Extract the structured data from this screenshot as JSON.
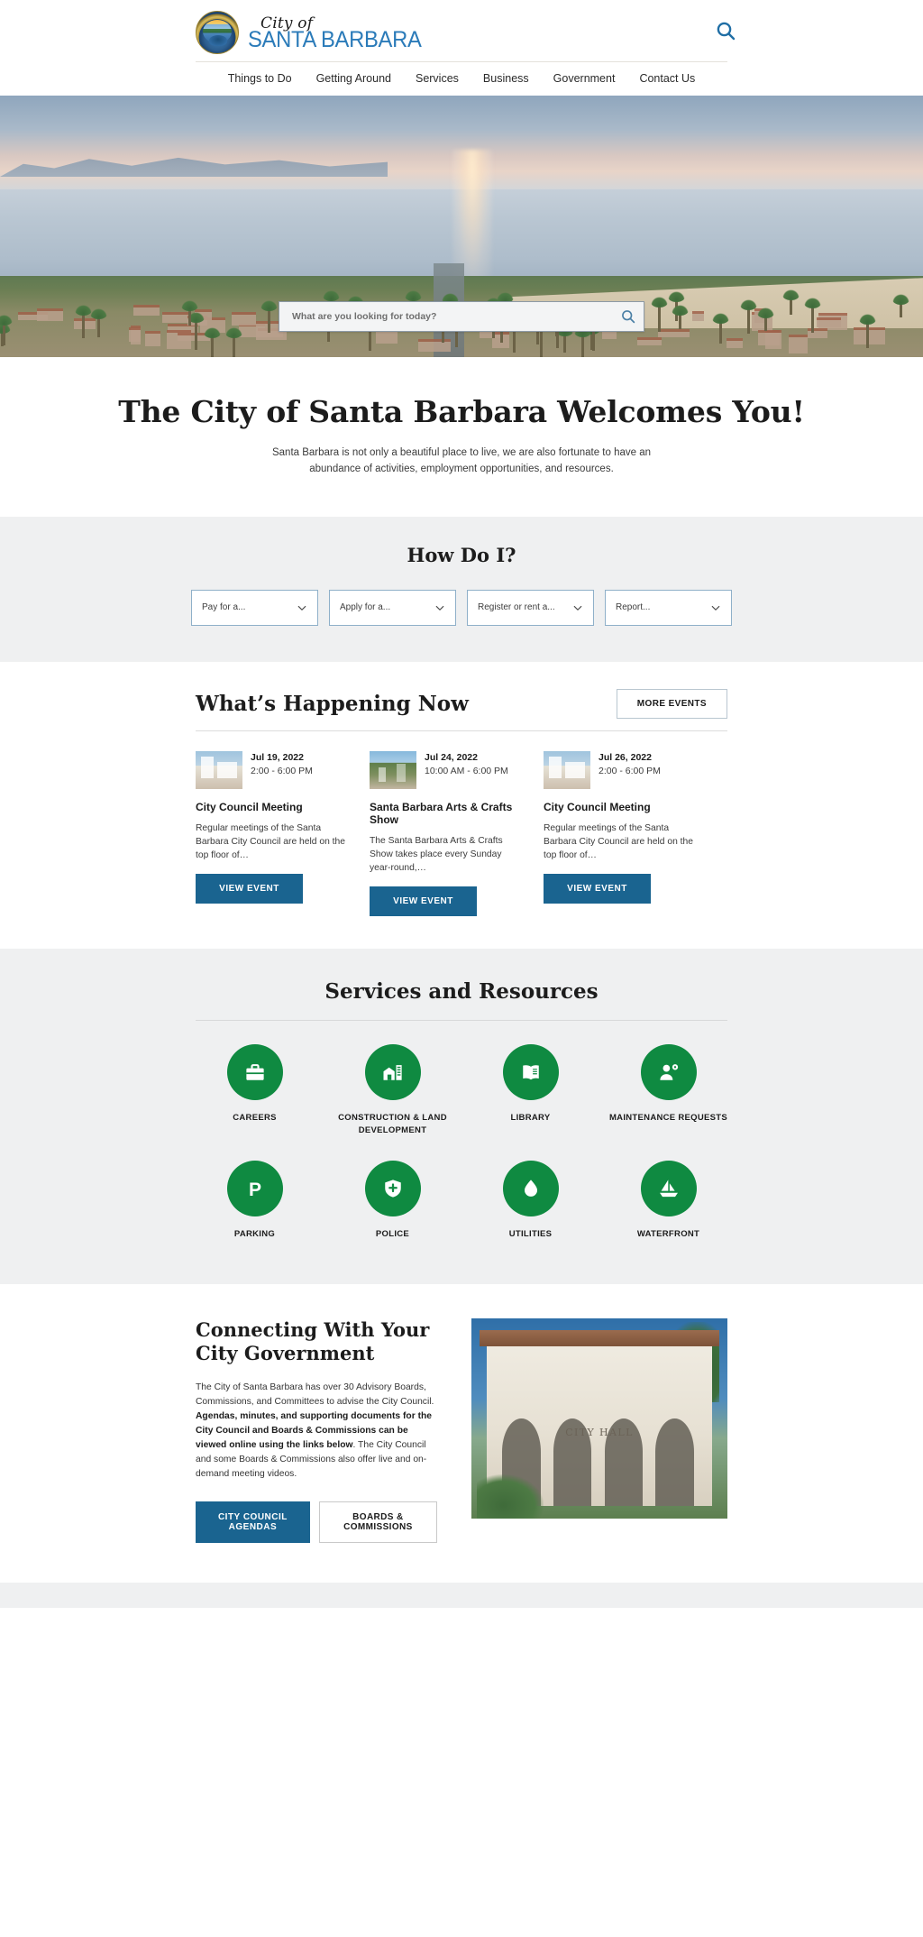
{
  "header": {
    "logo_script": "City of",
    "logo_city": "SANTA BARBARA",
    "search_icon": "search-icon",
    "nav": [
      {
        "label": "Things to Do"
      },
      {
        "label": "Getting Around"
      },
      {
        "label": "Services"
      },
      {
        "label": "Business"
      },
      {
        "label": "Government"
      },
      {
        "label": "Contact Us"
      }
    ]
  },
  "hero": {
    "search_placeholder": "What are you looking for today?",
    "search_value": "",
    "search_icon": "search-icon"
  },
  "welcome": {
    "heading": "The City of Santa Barbara Welcomes You!",
    "body": "Santa Barbara is not only a beautiful place to live, we are also fortunate to have an abundance of activities, employment opportunities, and resources."
  },
  "how_do_i": {
    "heading": "How Do I?",
    "dropdowns": [
      {
        "label": "Pay for a...",
        "icon": "chevron-down-icon"
      },
      {
        "label": "Apply for a...",
        "icon": "chevron-down-icon"
      },
      {
        "label": "Register or rent a...",
        "icon": "chevron-down-icon"
      },
      {
        "label": "Report...",
        "icon": "chevron-down-icon"
      }
    ]
  },
  "happening": {
    "heading": "What’s Happening Now",
    "more_events_label": "MORE EVENTS",
    "events": [
      {
        "date": "Jul 19, 2022",
        "time": "2:00 - 6:00 PM",
        "title": "City Council Meeting",
        "desc": "Regular meetings of the Santa Barbara City Council are held on the top floor of…",
        "button": "VIEW EVENT"
      },
      {
        "date": "Jul 24, 2022",
        "time": "10:00 AM - 6:00 PM",
        "title": "Santa Barbara Arts & Crafts Show",
        "desc": "The Santa Barbara Arts & Crafts Show takes place every Sunday year-round,…",
        "button": "VIEW EVENT"
      },
      {
        "date": "Jul 26, 2022",
        "time": "2:00 - 6:00 PM",
        "title": "City Council Meeting",
        "desc": "Regular meetings of the Santa Barbara City Council are held on the top floor of…",
        "button": "VIEW EVENT"
      }
    ]
  },
  "services": {
    "heading": "Services and Resources",
    "accent_color": "#0f8a41",
    "items": [
      {
        "label": "CAREERS",
        "icon": "briefcase-icon"
      },
      {
        "label": "CONSTRUCTION & LAND DEVELOPMENT",
        "icon": "building-crane-icon"
      },
      {
        "label": "LIBRARY",
        "icon": "open-book-icon"
      },
      {
        "label": "MAINTENANCE REQUESTS",
        "icon": "person-gear-icon"
      },
      {
        "label": "PARKING",
        "icon": "parking-p-icon"
      },
      {
        "label": "POLICE",
        "icon": "police-shield-icon"
      },
      {
        "label": "UTILITIES",
        "icon": "water-drop-icon"
      },
      {
        "label": "WATERFRONT",
        "icon": "sailboat-icon"
      }
    ]
  },
  "connecting": {
    "heading": "Connecting With Your City Government",
    "body_part1": "The City of Santa Barbara has over 30 Advisory Boards, Commissions, and Committees to advise the City Council. ",
    "body_bold": "Agendas, minutes, and supporting documents for the City Council and Boards & Commissions can be viewed online using the links below",
    "body_part2": ". The City Council and some Boards & Commissions also offer live and on-demand meeting videos.",
    "primary_button": "CITY COUNCIL AGENDAS",
    "secondary_button": "BOARDS & COMMISSIONS",
    "image_label": "CITY HALL"
  },
  "colors": {
    "brand_blue": "#2b7bb9",
    "button_blue": "#1a6490",
    "service_green": "#0f8a41",
    "section_gray": "#eff0f1"
  }
}
